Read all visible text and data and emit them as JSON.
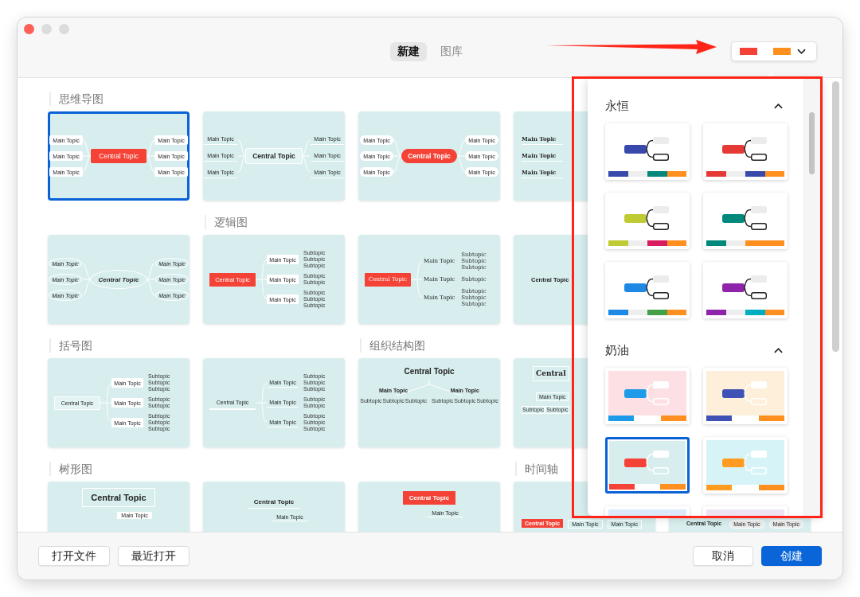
{
  "window": {
    "controls": [
      {
        "kind": "close"
      },
      {
        "kind": "minimize"
      },
      {
        "kind": "zoom"
      }
    ]
  },
  "tabs": [
    {
      "label": "新建",
      "selected": true
    },
    {
      "label": "图库",
      "selected": false
    }
  ],
  "theme_picker": {
    "expanded": true,
    "swatches": [
      {
        "color": "#f44336"
      },
      {
        "color": "#ff8f1f"
      }
    ]
  },
  "rows": [
    {
      "cards": [
        {
          "heading": "思维导图",
          "kind": "mindbox",
          "selected": true,
          "central": "Central Topic",
          "left": [
            "Main Topic",
            "Main Topic",
            "Main Topic"
          ],
          "right": [
            "Main Topic",
            "Main Topic",
            "Main Topic"
          ]
        },
        {
          "kind": "mindline",
          "selected": false,
          "central": "Central Topic",
          "left": [
            "Main Topic",
            "Main Topic",
            "Main Topic"
          ],
          "right": [
            "Main Topic",
            "Main Topic",
            "Main Topic"
          ]
        },
        {
          "kind": "mindpill",
          "selected": false,
          "central": "Central Topic",
          "left": [
            "Main Topic",
            "Main Topic",
            "Main Topic"
          ],
          "right": [
            "Main Topic",
            "Main Topic",
            "Main Topic"
          ]
        },
        {
          "kind": "mindserif",
          "selected": false,
          "left": [
            "Main Topic",
            "Main Topic",
            "Main Topic"
          ]
        }
      ]
    },
    {
      "cards": [
        {
          "kind": "mindellipse",
          "selected": false,
          "central": "Central Topic",
          "left": [
            "Main Topic",
            "Main Topic",
            "Main Topic"
          ],
          "right": [
            "Main Topic",
            "Main Topic",
            "Main Topic"
          ]
        },
        {
          "heading": "逻辑图",
          "kind": "logicbox",
          "selected": false,
          "central": "Central Topic",
          "groups": [
            {
              "label": "Main Topic",
              "subs": [
                "Subtopic",
                "Subtopic",
                "Subtopic"
              ]
            },
            {
              "label": "Main Topic",
              "subs": [
                "Subtopic",
                "Subtopic"
              ]
            },
            {
              "label": "Main Topic",
              "subs": [
                "Subtopic",
                "Subtopic",
                "Subtopic"
              ]
            }
          ]
        },
        {
          "kind": "logicserif",
          "selected": false,
          "central": "Central Topic",
          "groups": [
            {
              "label": "Main Topic",
              "subs": [
                "Subtopic",
                "Subtopic",
                "Subtopic"
              ]
            },
            {
              "label": "Main Topic",
              "subs": [
                "Subtopic"
              ]
            },
            {
              "label": "Main Topic",
              "subs": [
                "Subtopic",
                "Subtopic",
                "Subtopic"
              ]
            }
          ]
        },
        {
          "kind": "logicplain",
          "selected": false,
          "central": "Central Topic"
        }
      ]
    },
    {
      "cards": [
        {
          "heading": "括号图",
          "kind": "bracketbox",
          "selected": false,
          "central": "Central Topic",
          "groups": [
            {
              "label": "Main Topic",
              "subs": [
                "Subtopic",
                "Subtopic",
                "Subtopic"
              ]
            },
            {
              "label": "Main Topic",
              "subs": [
                "Subtopic",
                "Subtopic"
              ]
            },
            {
              "label": "Main Topic",
              "subs": [
                "Subtopic",
                "Subtopic",
                "Subtopic"
              ]
            }
          ]
        },
        {
          "kind": "bracketline",
          "selected": false,
          "central": "Central Topic",
          "groups": [
            {
              "label": "Main Topic",
              "subs": [
                "Subtopic",
                "Subtopic",
                "Subtopic"
              ]
            },
            {
              "label": "Main Topic",
              "subs": [
                "Subtopic",
                "Subtopic"
              ]
            },
            {
              "label": "Main Topic",
              "subs": [
                "Subtopic",
                "Subtopic",
                "Subtopic"
              ]
            }
          ]
        },
        {
          "heading": "组织结构图",
          "kind": "orgplain",
          "selected": false,
          "central": "Central Topic",
          "groups": [
            {
              "label": "Main Topic",
              "subs": [
                "Subtopic",
                "Subtopic",
                "Subtopic"
              ]
            },
            {
              "label": "Main Topic",
              "subs": [
                "Subtopic",
                "Subtopic",
                "Subtopic"
              ]
            }
          ]
        },
        {
          "kind": "orgbox",
          "selected": false,
          "central": "Central",
          "groups": [
            {
              "label": "Main Topic",
              "subs": [
                "Subtopic",
                "Subtopic"
              ]
            }
          ]
        }
      ]
    },
    {
      "cards": [
        {
          "heading": "树形图",
          "kind": "treebox",
          "selected": false,
          "central": "Central Topic",
          "groups": [
            {
              "label": "Main Topic"
            }
          ]
        },
        {
          "kind": "treeline",
          "selected": false,
          "central": "Central Topic",
          "groups": [
            {
              "label": "Main Topic"
            }
          ]
        },
        {
          "kind": "treered",
          "selected": false,
          "central": "Central Topic",
          "groups": [
            {
              "label": "Main Topic"
            }
          ]
        },
        {
          "heading": "时间轴",
          "kind": "timelinered",
          "selected": false,
          "central": "Central Topic",
          "groups": [
            {
              "label": "Main Topic"
            },
            {
              "label": "Main Topic"
            }
          ]
        },
        {
          "kind": "timelineplain",
          "selected": false,
          "central": "Central Topic",
          "groups": [
            {
              "label": "Main Topic"
            },
            {
              "label": "Main Topic"
            }
          ]
        }
      ]
    }
  ],
  "theme_groups": [
    {
      "title": "永恒",
      "expanded": true,
      "kind": "outline",
      "themes": [
        {
          "color": "#3949ab",
          "palette": [
            {
              "color": "#3949ab"
            },
            {
              "color": "#eeeeee"
            },
            {
              "color": "#00897b"
            },
            {
              "color": "#ff8f1f"
            }
          ],
          "selected": false
        },
        {
          "color": "#e53935",
          "palette": [
            {
              "color": "#e53935"
            },
            {
              "color": "#eeeeee"
            },
            {
              "color": "#3949ab"
            },
            {
              "color": "#ff8f1f"
            }
          ],
          "selected": false
        },
        {
          "color": "#c0ca33",
          "palette": [
            {
              "color": "#c0ca33"
            },
            {
              "color": "#eeeeee"
            },
            {
              "color": "#d81b60"
            },
            {
              "color": "#ff8f1f"
            }
          ],
          "selected": false
        },
        {
          "color": "#00897b",
          "palette": [
            {
              "color": "#00897b"
            },
            {
              "color": "#eeeeee"
            },
            {
              "color": "#ff8f1f"
            },
            {
              "color": "#ff8f1f"
            }
          ],
          "selected": false
        },
        {
          "color": "#1e88e5",
          "palette": [
            {
              "color": "#1e88e5"
            },
            {
              "color": "#eeeeee"
            },
            {
              "color": "#43a047"
            },
            {
              "color": "#ff8f1f"
            }
          ],
          "selected": false
        },
        {
          "color": "#8e24aa",
          "palette": [
            {
              "color": "#8e24aa"
            },
            {
              "color": "#eeeeee"
            },
            {
              "color": "#00acc1"
            },
            {
              "color": "#ff8f1f"
            }
          ],
          "selected": false
        }
      ]
    },
    {
      "title": "奶油",
      "expanded": true,
      "kind": "soft",
      "themes": [
        {
          "color": "#1e9be8",
          "preview": {
            "color": "#fde0e4"
          },
          "palette": [
            {
              "color": "#1e9be8"
            },
            {
              "color": "#ff8f1f"
            }
          ],
          "selected": false
        },
        {
          "color": "#3f51b5",
          "preview": {
            "color": "#fdefd9"
          },
          "palette": [
            {
              "color": "#3f51b5"
            },
            {
              "color": "#ff8f1f"
            }
          ],
          "selected": false
        },
        {
          "color": "#f44336",
          "preview": {
            "color": "#d8eeee"
          },
          "palette": [
            {
              "color": "#f44336"
            },
            {
              "color": "#ff8f1f"
            }
          ],
          "selected": true
        },
        {
          "color": "#ff9b20",
          "preview": {
            "color": "#d6f4f7"
          },
          "palette": [
            {
              "color": "#ff9b20"
            },
            {
              "color": "#ff8f1f"
            }
          ],
          "selected": false
        },
        {
          "preview": {
            "color": "#dbeafb"
          },
          "selected": false
        },
        {
          "preview": {
            "color": "#ede3f3"
          },
          "selected": false
        }
      ]
    }
  ],
  "footer": {
    "left_buttons": [
      "打开文件",
      "最近打开"
    ],
    "right_buttons": [
      {
        "label": "取消",
        "kind": "secondary"
      },
      {
        "label": "创建",
        "kind": "primary"
      }
    ]
  }
}
